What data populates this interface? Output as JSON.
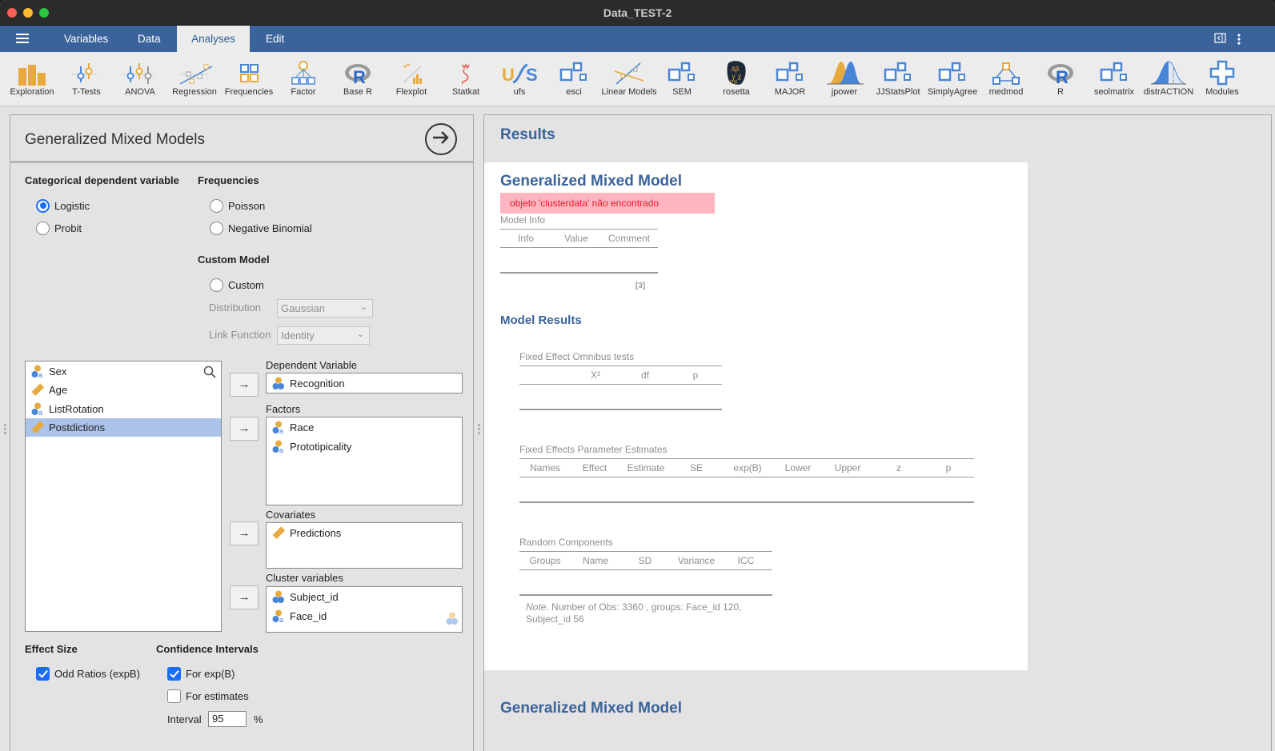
{
  "window": {
    "title": "Data_TEST-2"
  },
  "menubar": {
    "tabs": [
      {
        "label": "Variables",
        "active": false
      },
      {
        "label": "Data",
        "active": false
      },
      {
        "label": "Analyses",
        "active": true
      },
      {
        "label": "Edit",
        "active": false
      }
    ]
  },
  "ribbon": {
    "items": [
      {
        "label": "Exploration",
        "icon": "bar-chart-icon"
      },
      {
        "label": "T-Tests",
        "icon": "ttest-icon"
      },
      {
        "label": "ANOVA",
        "icon": "anova-icon"
      },
      {
        "label": "Regression",
        "icon": "regression-icon"
      },
      {
        "label": "Frequencies",
        "icon": "frequencies-icon"
      },
      {
        "label": "Factor",
        "icon": "factor-icon"
      },
      {
        "label": "Base R",
        "icon": "r-logo-icon"
      },
      {
        "label": "Flexplot",
        "icon": "flexplot-icon"
      },
      {
        "label": "Statkat",
        "icon": "statkat-icon"
      },
      {
        "label": "ufs",
        "icon": "ufs-icon"
      },
      {
        "label": "esci",
        "icon": "module-squares-icon"
      },
      {
        "label": "Linear Models",
        "icon": "linear-models-icon"
      },
      {
        "label": "SEM",
        "icon": "module-squares-icon"
      },
      {
        "label": "rosetta",
        "icon": "rosetta-icon"
      },
      {
        "label": "MAJOR",
        "icon": "module-squares-icon"
      },
      {
        "label": "jpower",
        "icon": "jpower-icon"
      },
      {
        "label": "JJStatsPlot",
        "icon": "module-squares-icon"
      },
      {
        "label": "SimplyAgree",
        "icon": "module-squares-icon"
      },
      {
        "label": "medmod",
        "icon": "medmod-icon"
      },
      {
        "label": "R",
        "icon": "r-logo-icon"
      },
      {
        "label": "seolmatrix",
        "icon": "module-squares-icon"
      },
      {
        "label": "distrACTION",
        "icon": "distribution-icon"
      },
      {
        "label": "Modules",
        "icon": "plus-icon"
      }
    ]
  },
  "options": {
    "title": "Generalized Mixed Models",
    "categorical": {
      "heading": "Categorical dependent variable",
      "options": [
        {
          "label": "Logistic",
          "selected": true
        },
        {
          "label": "Probit",
          "selected": false
        }
      ]
    },
    "frequencies": {
      "heading": "Frequencies",
      "options": [
        {
          "label": "Poisson",
          "selected": false
        },
        {
          "label": "Negative Binomial",
          "selected": false
        }
      ]
    },
    "custom": {
      "heading": "Custom Model",
      "option": {
        "label": "Custom",
        "selected": false
      },
      "distribution_label": "Distribution",
      "distribution_value": "Gaussian",
      "link_label": "Link Function",
      "link_value": "Identity"
    },
    "available_variables": [
      {
        "name": "Sex",
        "type": "nominal-text",
        "selected": false
      },
      {
        "name": "Age",
        "type": "continuous",
        "selected": false
      },
      {
        "name": "ListRotation",
        "type": "nominal-text",
        "selected": false
      },
      {
        "name": "Postdictions",
        "type": "continuous",
        "selected": true
      }
    ],
    "arrow_glyph": "→",
    "dependent": {
      "label": "Dependent Variable",
      "items": [
        {
          "name": "Recognition",
          "type": "nominal"
        }
      ]
    },
    "factors": {
      "label": "Factors",
      "items": [
        {
          "name": "Race",
          "type": "nominal-text"
        },
        {
          "name": "Prototipicality",
          "type": "nominal-text"
        }
      ]
    },
    "covariates": {
      "label": "Covariates",
      "items": [
        {
          "name": "Predictions",
          "type": "continuous"
        }
      ]
    },
    "cluster": {
      "label": "Cluster variables",
      "items": [
        {
          "name": "Subject_id",
          "type": "nominal"
        },
        {
          "name": "Face_id",
          "type": "nominal-text"
        }
      ]
    },
    "effect_size": {
      "heading": "Effect Size",
      "options": [
        {
          "label": "Odd Ratios (expB)",
          "checked": true
        }
      ]
    },
    "confidence": {
      "heading": "Confidence Intervals",
      "options": [
        {
          "label": "For exp(B)",
          "checked": true
        },
        {
          "label": "For estimates",
          "checked": false
        }
      ],
      "interval_label": "Interval",
      "interval_value": "95",
      "interval_unit": "%"
    }
  },
  "results": {
    "title": "Results",
    "analysis_title": "Generalized Mixed Model",
    "error": "objeto 'clusterdata' não encontrado",
    "model_info": {
      "title": "Model Info",
      "columns": [
        "Info",
        "Value",
        "Comment"
      ],
      "footnote": "[3]"
    },
    "model_results_heading": "Model Results",
    "omnibus": {
      "title": "Fixed Effect Omnibus tests",
      "columns": [
        "",
        "X²",
        "df",
        "p"
      ]
    },
    "params": {
      "title": "Fixed Effects Parameter Estimates",
      "columns": [
        "Names",
        "Effect",
        "Estimate",
        "SE",
        "exp(B)",
        "Lower",
        "Upper",
        "z",
        "p"
      ]
    },
    "random": {
      "title": "Random Components",
      "columns": [
        "Groups",
        "Name",
        "SD",
        "Variance",
        "ICC"
      ],
      "note_prefix": "Note.",
      "note_line1": " Number of Obs: 3360 , groups: Face_id 120,",
      "note_line2": "Subject_id 56"
    },
    "next_analysis_title": "Generalized Mixed Model"
  },
  "colors": {
    "brand_blue": "#3a639c",
    "selection": "#abc3e8",
    "error_bg": "#ffb6c1",
    "error_text": "#e8192c",
    "accent": "#1a6dfc"
  }
}
